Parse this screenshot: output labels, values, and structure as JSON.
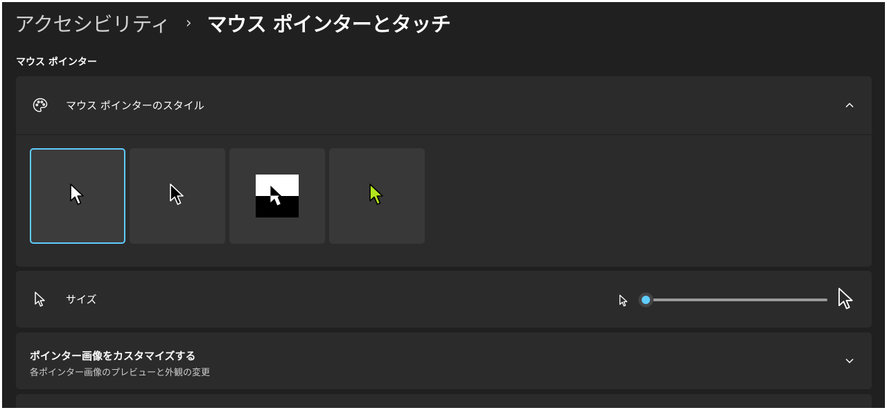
{
  "breadcrumb": {
    "parent": "アクセシビリティ",
    "separator": "›",
    "current": "マウス ポインターとタッチ"
  },
  "section": {
    "title": "マウス ポインター"
  },
  "pointer_style": {
    "label": "マウス ポインターのスタイル",
    "icon": "palette-icon",
    "expanded": true,
    "options": [
      {
        "name": "white",
        "selected": true
      },
      {
        "name": "black",
        "selected": false
      },
      {
        "name": "inverted",
        "selected": false
      },
      {
        "name": "custom",
        "selected": false,
        "color": "#b4e61e"
      }
    ]
  },
  "size": {
    "label": "サイズ",
    "icon": "pointer-icon",
    "slider_value_fraction": 0.0
  },
  "customize": {
    "title": "ポインター画像をカスタマイズする",
    "subtitle": "各ポインター画像のプレビューと外観の変更"
  },
  "colors": {
    "accent": "#60cdff",
    "background": "#202020",
    "card": "#2b2b2b",
    "custom_cursor": "#b4e61e"
  }
}
